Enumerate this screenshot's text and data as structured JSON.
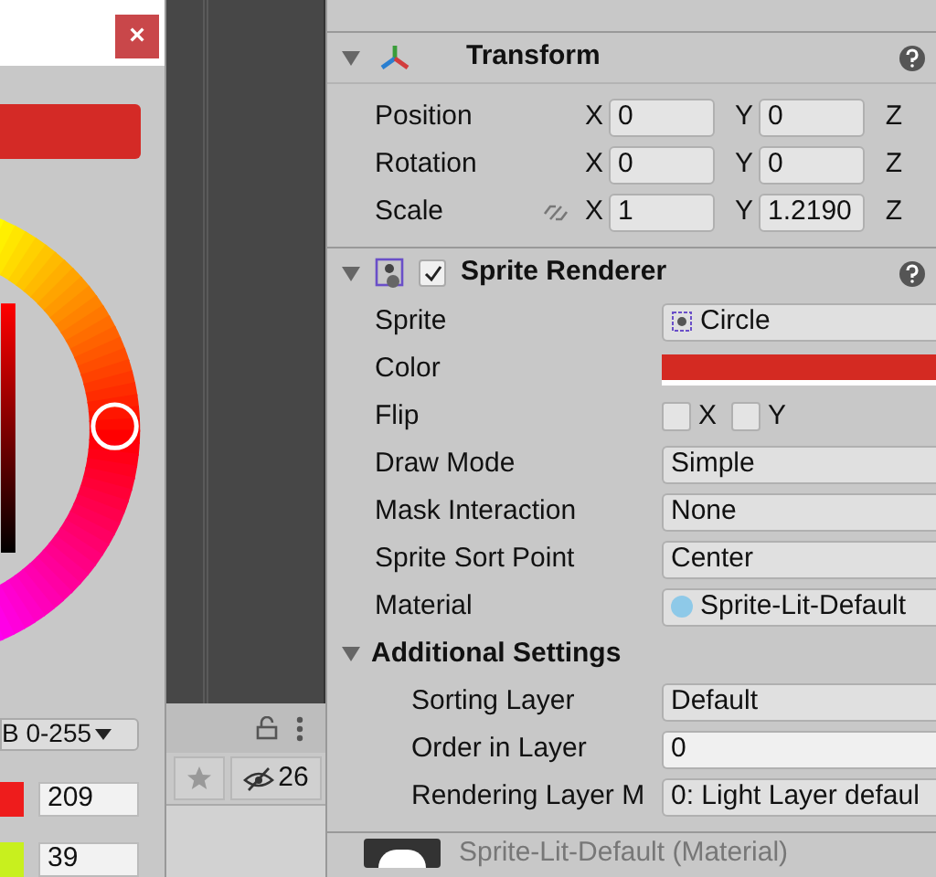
{
  "color_picker": {
    "close": "×",
    "swatch": {
      "color": "#d42a26"
    },
    "mode": "B 0-255",
    "channels": [
      {
        "color": "#ee1c1c",
        "value": "209"
      },
      {
        "color": "#c8f01e",
        "value": "39"
      }
    ]
  },
  "scene_toolbar": {
    "count": "26"
  },
  "transform": {
    "title": "Transform",
    "expanded": true,
    "rows": [
      {
        "label": "Position",
        "x": {
          "axis": "X",
          "value": "0"
        },
        "y": {
          "axis": "Y",
          "value": "0"
        },
        "z": {
          "axis": "Z"
        },
        "linked": false
      },
      {
        "label": "Rotation",
        "x": {
          "axis": "X",
          "value": "0"
        },
        "y": {
          "axis": "Y",
          "value": "0"
        },
        "z": {
          "axis": "Z"
        },
        "linked": false
      },
      {
        "label": "Scale",
        "x": {
          "axis": "X",
          "value": "1"
        },
        "y": {
          "axis": "Y",
          "value": "1.2190"
        },
        "z": {
          "axis": "Z"
        },
        "linked": true
      }
    ]
  },
  "sprite_renderer": {
    "title": "Sprite Renderer",
    "enabled": true,
    "expanded": true,
    "properties": [
      {
        "kind": "object",
        "label": "Sprite",
        "value": "Circle"
      },
      {
        "kind": "color",
        "label": "Color",
        "color": "#d42a22"
      },
      {
        "kind": "flip",
        "label": "Flip",
        "x": {
          "label": "X",
          "checked": false
        },
        "y": {
          "label": "Y",
          "checked": false
        }
      },
      {
        "kind": "dropdown",
        "label": "Draw Mode",
        "value": "Simple"
      },
      {
        "kind": "dropdown",
        "label": "Mask Interaction",
        "value": "None"
      },
      {
        "kind": "dropdown",
        "label": "Sprite Sort Point",
        "value": "Center"
      },
      {
        "kind": "material",
        "label": "Material",
        "value": "Sprite-Lit-Default"
      }
    ],
    "additional_settings": {
      "title": "Additional Settings",
      "expanded": true,
      "properties": [
        {
          "kind": "dropdown",
          "label": "Sorting Layer",
          "value": "Default"
        },
        {
          "kind": "number",
          "label": "Order in Layer",
          "value": "0"
        },
        {
          "kind": "dropdown",
          "label": "Rendering Layer M",
          "value": "0: Light Layer defaul"
        }
      ]
    }
  },
  "material_preview": {
    "name": "Sprite-Lit-Default (Material)"
  }
}
